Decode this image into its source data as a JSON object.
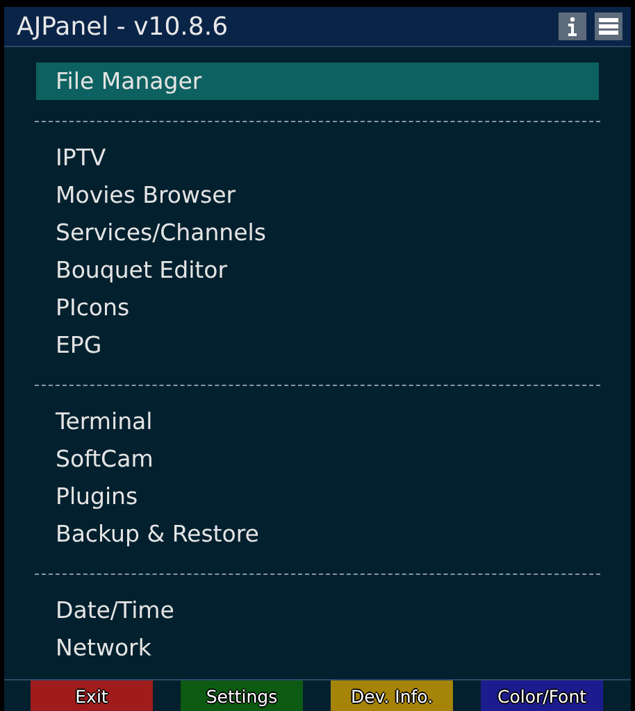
{
  "window": {
    "title": "AJPanel - v10.8.6"
  },
  "groups": [
    {
      "items": [
        {
          "label": "File Manager",
          "selected": true
        }
      ]
    },
    {
      "items": [
        {
          "label": "IPTV",
          "selected": false
        },
        {
          "label": "Movies Browser",
          "selected": false
        },
        {
          "label": "Services/Channels",
          "selected": false
        },
        {
          "label": "Bouquet Editor",
          "selected": false
        },
        {
          "label": "PIcons",
          "selected": false
        },
        {
          "label": "EPG",
          "selected": false
        }
      ]
    },
    {
      "items": [
        {
          "label": "Terminal",
          "selected": false
        },
        {
          "label": "SoftCam",
          "selected": false
        },
        {
          "label": "Plugins",
          "selected": false
        },
        {
          "label": "Backup & Restore",
          "selected": false
        }
      ]
    },
    {
      "items": [
        {
          "label": "Date/Time",
          "selected": false
        },
        {
          "label": "Network",
          "selected": false
        }
      ]
    }
  ],
  "buttons": [
    {
      "label": "Exit",
      "color": "#a01c1c"
    },
    {
      "label": "Settings",
      "color": "#0d5a13"
    },
    {
      "label": "Dev. Info.",
      "color": "#a58408"
    },
    {
      "label": "Color/Font",
      "color": "#1c1c8e"
    }
  ]
}
